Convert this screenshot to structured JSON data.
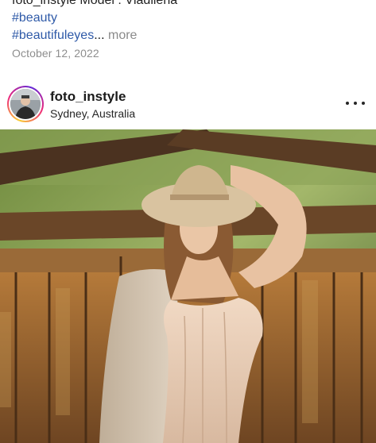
{
  "caption": {
    "cut_line": "foto_instyle Model : Vladilena",
    "hashtags": [
      "#beauty",
      "#beautifuleyes"
    ],
    "ellipsis": "...",
    "more_label": "more"
  },
  "date": "October 12, 2022",
  "post": {
    "username": "foto_instyle",
    "location": "Sydney, Australia",
    "more_icon": "ellipsis-horizontal-icon",
    "image_alt": "Woman in a wide-brimmed hat and cream corset dress posing in front of a rustic wooden fence"
  },
  "colors": {
    "hashtag": "#2f5aa8",
    "meta_gray": "#8e8e8e",
    "ring_start": "#f9ce34",
    "ring_mid": "#ee2a7b",
    "ring_end": "#6228d7"
  }
}
